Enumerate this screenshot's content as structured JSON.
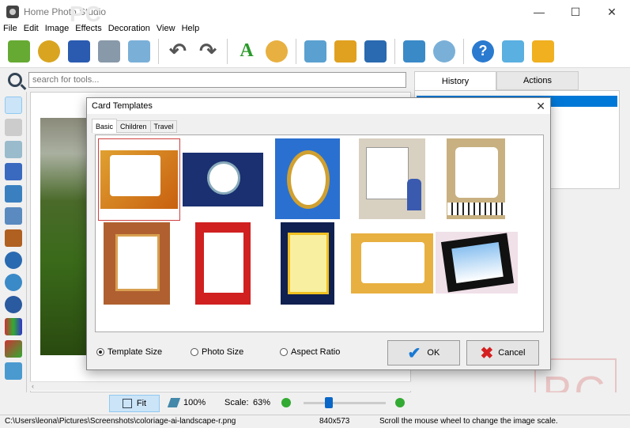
{
  "window": {
    "title": "Home Photo Studio",
    "watermark": "PC",
    "minimize": "—",
    "maximize": "☐",
    "close": "✕"
  },
  "menu": [
    "File",
    "Edit",
    "Image",
    "Effects",
    "Decoration",
    "View",
    "Help"
  ],
  "search": {
    "placeholder": "search for tools..."
  },
  "right_tabs": {
    "history": "History",
    "actions": "Actions"
  },
  "bottom": {
    "fit": "Fit",
    "zoom": "100%",
    "scale_label": "Scale:",
    "scale_value": "63%"
  },
  "status": {
    "path": "C:\\Users\\leona\\Pictures\\Screenshots\\coloriage-ai-landscape-r.png",
    "size": "840x573",
    "message": "Scroll the mouse wheel to change the image scale."
  },
  "dialog": {
    "title": "Card Templates",
    "close": "✕",
    "tabs": [
      "Basic",
      "Children",
      "Travel"
    ],
    "options": {
      "template_size": "Template Size",
      "photo_size": "Photo Size",
      "aspect_ratio": "Aspect Ratio"
    },
    "selected_option": "template_size",
    "ok": "OK",
    "cancel": "Cancel"
  },
  "colors": {
    "accent": "#0078d7",
    "selection": "#d04040"
  },
  "watermark_logo": "PC"
}
